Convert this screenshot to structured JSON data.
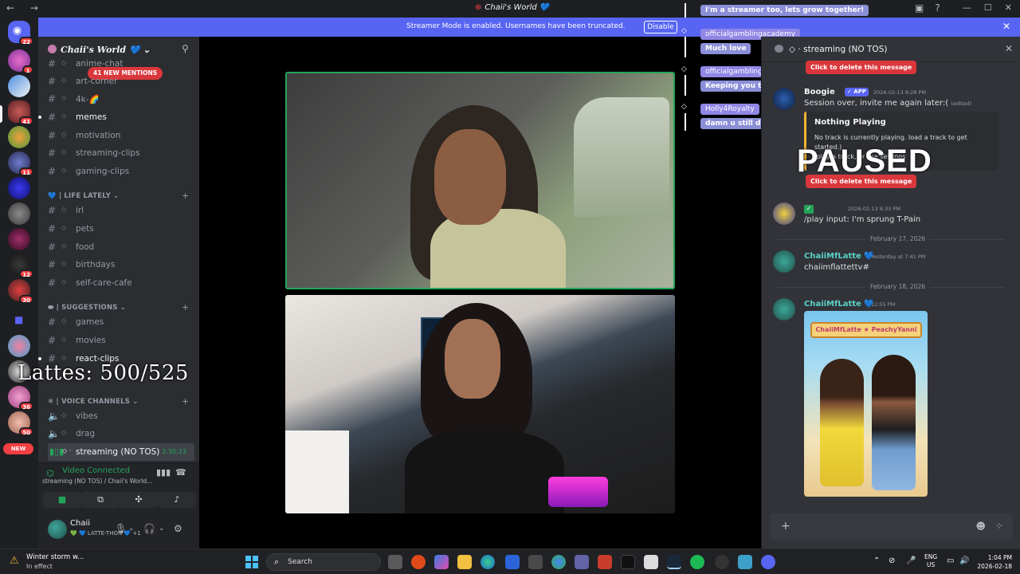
{
  "titlebar": {
    "nav": "← →",
    "title": "Chaii's World",
    "heart": "💙",
    "icons": [
      "inbox-icon",
      "help-icon"
    ],
    "controls": [
      "—",
      "☐",
      "✕"
    ]
  },
  "banner": {
    "text": "Streamer Mode is enabled. Usernames have been truncated.",
    "button": "Disable",
    "close": "✕"
  },
  "rail": {
    "badges": [
      "22",
      "1",
      "41",
      "11",
      "12",
      "30",
      "36",
      "50"
    ],
    "new_tag": "NEW"
  },
  "server": {
    "name": "Chaii's World",
    "heart": "💙",
    "chevron": "⌄",
    "mentions_badge": "41 NEW MENTIONS"
  },
  "channels": {
    "top": [
      {
        "label": "anime-chat",
        "bold": false
      },
      {
        "label": "art-corner",
        "bold": false
      },
      {
        "label": "4k-🌈",
        "bold": false
      },
      {
        "label": "memes",
        "bold": true
      },
      {
        "label": "motivation",
        "bold": false
      },
      {
        "label": "streaming-clips",
        "bold": false
      },
      {
        "label": "gaming-clips",
        "bold": false
      }
    ],
    "cat_life": "💙 | LIFE LATELY ⌄",
    "life": [
      {
        "label": "irl"
      },
      {
        "label": "pets"
      },
      {
        "label": "food"
      },
      {
        "label": "birthdays"
      },
      {
        "label": "self-care-cafe"
      }
    ],
    "cat_suggestions": "| SUGGESTIONS ⌄",
    "suggestions": [
      {
        "label": "games"
      },
      {
        "label": "movies"
      },
      {
        "label": "react-clips"
      }
    ],
    "cat_voice": "❄ | VOICE CHANNELS ⌄",
    "voice": [
      {
        "label": "vibes"
      },
      {
        "label": "drag"
      }
    ],
    "active_voice": {
      "label": "streaming (NO TOS)",
      "time": "2:30:23"
    }
  },
  "overlay": {
    "lattes": "Lattes: 500/525"
  },
  "voice_panel": {
    "status": "Video Connected",
    "sub": "streaming (NO TOS) / Chaii's World..."
  },
  "user": {
    "name": "Chaii",
    "status": "💚 💙 LATTE-THON 💙 +1"
  },
  "chat_overlay": [
    {
      "text": "I'm a streamer too, lets grow together!",
      "kind": "m"
    },
    {
      "text": "officialgamblingacademy",
      "kind": "uname"
    },
    {
      "text": "Much love",
      "kind": "m"
    },
    {
      "text": "officialgamblingacademy",
      "kind": "uname"
    },
    {
      "text": "Keeping you tabbed",
      "kind": "m"
    },
    {
      "text": "Holly4Royalty",
      "kind": "uname"
    },
    {
      "text": "damn u still driving",
      "kind": "m"
    }
  ],
  "panel": {
    "title": "streaming (NO TOS)",
    "delete_label": "Click to delete this message",
    "boogie": {
      "name": "Boogie",
      "app": "✓ APP",
      "time": "2026-02-13 8:28 PM",
      "text": "Session over, invite me again later:(",
      "edited": "(edited)"
    },
    "embed": {
      "title": "Nothing Playing",
      "desc": "No track is currently playing. load a track to get started.)",
      "desc2": "/play a track, or use settings"
    },
    "paused": "PAUSED",
    "play_msg": {
      "time": "2026-02-13 8:33 PM",
      "text": "/play input: I'm sprung T-Pain"
    },
    "divider1": "February 17, 2026",
    "msg_latte1": {
      "name": "ChaiiMfLatte 💙",
      "time": "Yesterday at 7:41 PM",
      "text": "chaiimflattettv#"
    },
    "divider2": "February 18, 2026",
    "msg_latte2": {
      "name": "ChaiiMfLatte 💙",
      "time": "12:55 PM"
    },
    "art_title": "ChaiiMfLatte ★ PeachyYanni"
  },
  "taskbar": {
    "weather_title": "Winter storm w...",
    "weather_sub": "In effect",
    "search": "Search",
    "lang1": "ENG",
    "lang2": "US",
    "time": "1:04 PM",
    "date": "2026-02-18"
  }
}
